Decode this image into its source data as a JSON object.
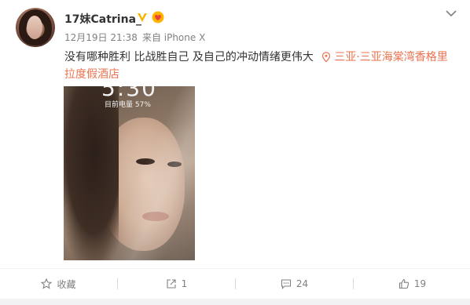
{
  "post": {
    "username": "17妹Catrina_",
    "time": "12月19日 21:38",
    "source": "来自 iPhone X",
    "text": "没有哪种胜利 比战胜自己 及自己的冲动情绪更伟大",
    "location_line1": "三亚·三亚海棠湾香格里",
    "location_line2": "拉度假酒店",
    "image": {
      "clock": "5:30",
      "battery": "目前电量 57%"
    }
  },
  "icons": {
    "verified": "verified-v-icon",
    "heart_badge": "heart-badge-icon",
    "more": "chevron-down-icon",
    "location": "location-pin-icon",
    "favorite": "star-icon",
    "repost": "repost-icon",
    "comment": "comment-icon",
    "like": "thumbs-up-icon"
  },
  "actions": {
    "favorite_label": "收藏",
    "repost_count": "1",
    "comment_count": "24",
    "like_count": "19"
  },
  "colors": {
    "accent": "#eb7350",
    "verified": "#f7b500",
    "text": "#333333",
    "muted": "#808080"
  }
}
